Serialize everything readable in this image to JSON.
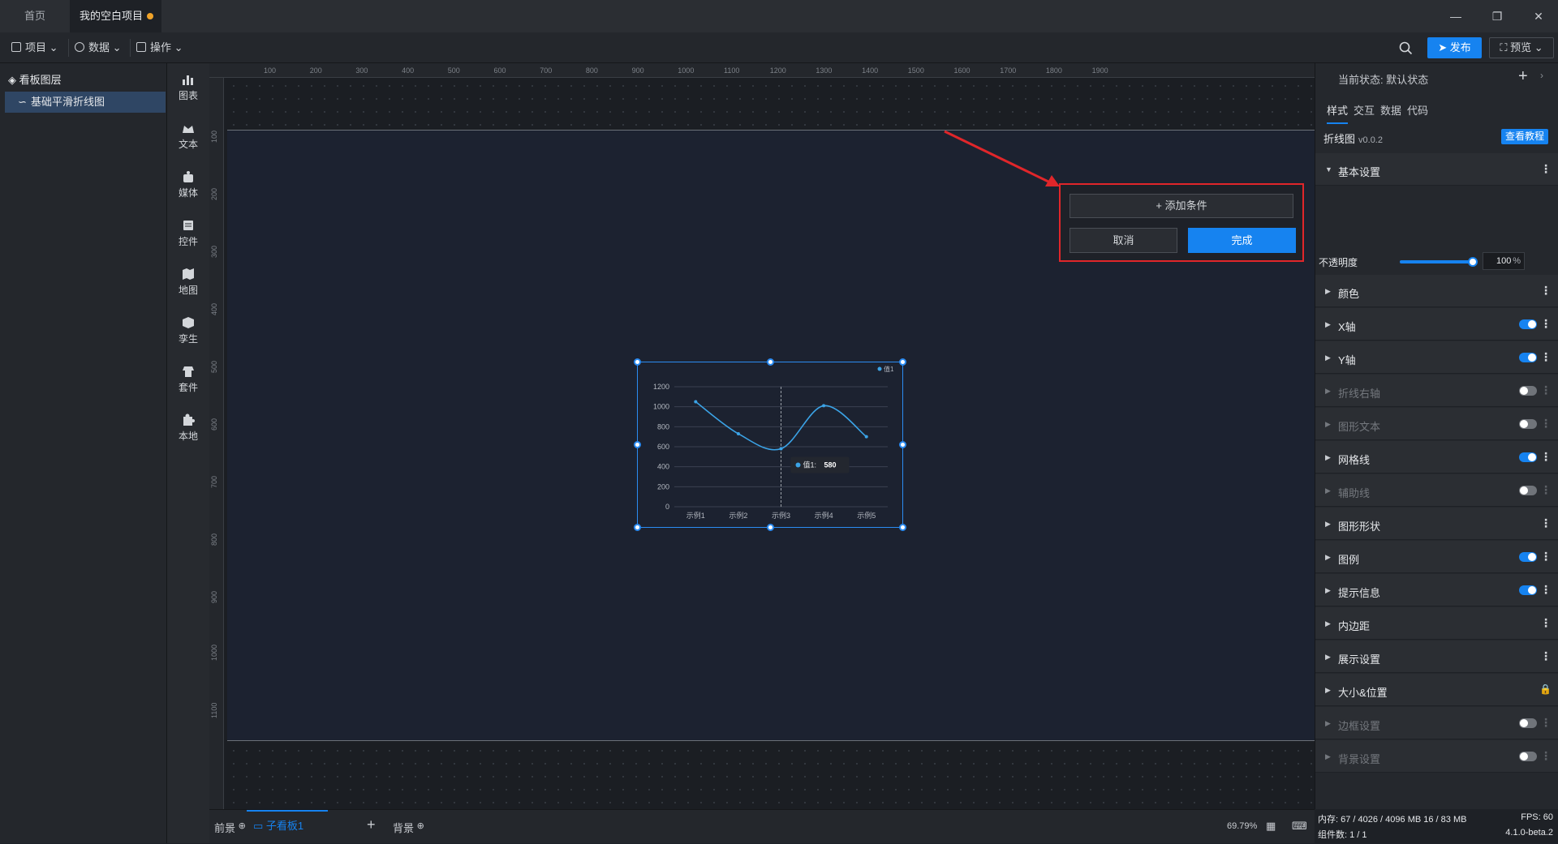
{
  "tabs": [
    {
      "label": "首页"
    },
    {
      "label": "我的空白项目",
      "unsaved_dot_color": "#f0a329"
    }
  ],
  "window": {
    "min_icon": "minimize-icon",
    "restore_icon": "restore-icon",
    "close_icon": "close-icon"
  },
  "toolbar": {
    "menus": [
      {
        "label": "项目",
        "icon": "file-icon"
      },
      {
        "label": "数据",
        "icon": "database-icon"
      },
      {
        "label": "操作",
        "icon": "grid-icon"
      }
    ],
    "publish_label": "发布",
    "preview_label": "预览",
    "search_icon": "search-icon"
  },
  "layers": {
    "title": "看板图层",
    "items": [
      {
        "label": "基础平滑折线图"
      }
    ]
  },
  "components": [
    "图表",
    "文本",
    "媒体",
    "控件",
    "地图",
    "孪生",
    "套件",
    "本地"
  ],
  "rulers": {
    "h": [
      "100",
      "200",
      "300",
      "400",
      "500",
      "600",
      "700",
      "800",
      "900",
      "1000",
      "1100",
      "1200",
      "1300",
      "1400",
      "1500",
      "1600",
      "1700",
      "1800",
      "1900"
    ],
    "v": [
      "100",
      "200",
      "300",
      "400",
      "500",
      "600",
      "700",
      "800",
      "900",
      "1000",
      "1100"
    ]
  },
  "popup": {
    "add_label": "添加条件",
    "cancel_label": "取消",
    "done_label": "完成"
  },
  "chart_data": {
    "type": "line",
    "categories": [
      "示例1",
      "示例2",
      "示例3",
      "示例4",
      "示例5"
    ],
    "series": [
      {
        "name": "值1",
        "values": [
          1050,
          730,
          580,
          1010,
          700
        ]
      }
    ],
    "ylim": [
      0,
      1200
    ],
    "yticks": [
      0,
      200,
      400,
      600,
      800,
      1000,
      1200
    ],
    "smooth": true,
    "legend": "top-right",
    "tooltip": {
      "label": "值1:",
      "value": "580"
    },
    "line_color": "#3ba3e6"
  },
  "bottom": {
    "foreground": "前景",
    "subboard": "子看板1",
    "background": "背景",
    "zoom": "69.79%"
  },
  "rpanel": {
    "state_label": "当前状态:",
    "state_value": "默认状态",
    "tabs": [
      "样式",
      "交互",
      "数据",
      "代码"
    ],
    "chart_name": "折线图",
    "chart_version": "v0.0.2",
    "tutorial_label": "查看教程",
    "basic_label": "基本设置",
    "opacity_label": "不透明度",
    "opacity_value": "100",
    "opacity_unit": "%",
    "opacity_fraction": 1.0,
    "sections": [
      {
        "label": "颜色",
        "toggle": null,
        "dim": false
      },
      {
        "label": "X轴",
        "toggle": "on",
        "dim": false
      },
      {
        "label": "Y轴",
        "toggle": "on",
        "dim": false
      },
      {
        "label": "折线右轴",
        "toggle": "off",
        "dim": true
      },
      {
        "label": "图形文本",
        "toggle": "off",
        "dim": true
      },
      {
        "label": "网格线",
        "toggle": "on",
        "dim": false
      },
      {
        "label": "辅助线",
        "toggle": "off",
        "dim": true
      },
      {
        "label": "图形形状",
        "toggle": null,
        "dim": false
      },
      {
        "label": "图例",
        "toggle": "on",
        "dim": false
      },
      {
        "label": "提示信息",
        "toggle": "on",
        "dim": false
      },
      {
        "label": "内边距",
        "toggle": null,
        "dim": false
      },
      {
        "label": "展示设置",
        "toggle": null,
        "dim": false
      },
      {
        "label": "大小&位置",
        "toggle": "lock",
        "dim": false
      },
      {
        "label": "边框设置",
        "toggle": "off",
        "dim": true
      },
      {
        "label": "背景设置",
        "toggle": "off",
        "dim": true
      }
    ]
  },
  "status": {
    "memory_label": "内存:",
    "memory_value": "67 / 4026 / 4096 MB",
    "memory_extra": "16 / 83 MB",
    "fps_label": "FPS:",
    "fps_value": "60",
    "count_label": "组件数:",
    "count_value": "1 / 1",
    "version": "4.1.0-beta.2"
  }
}
